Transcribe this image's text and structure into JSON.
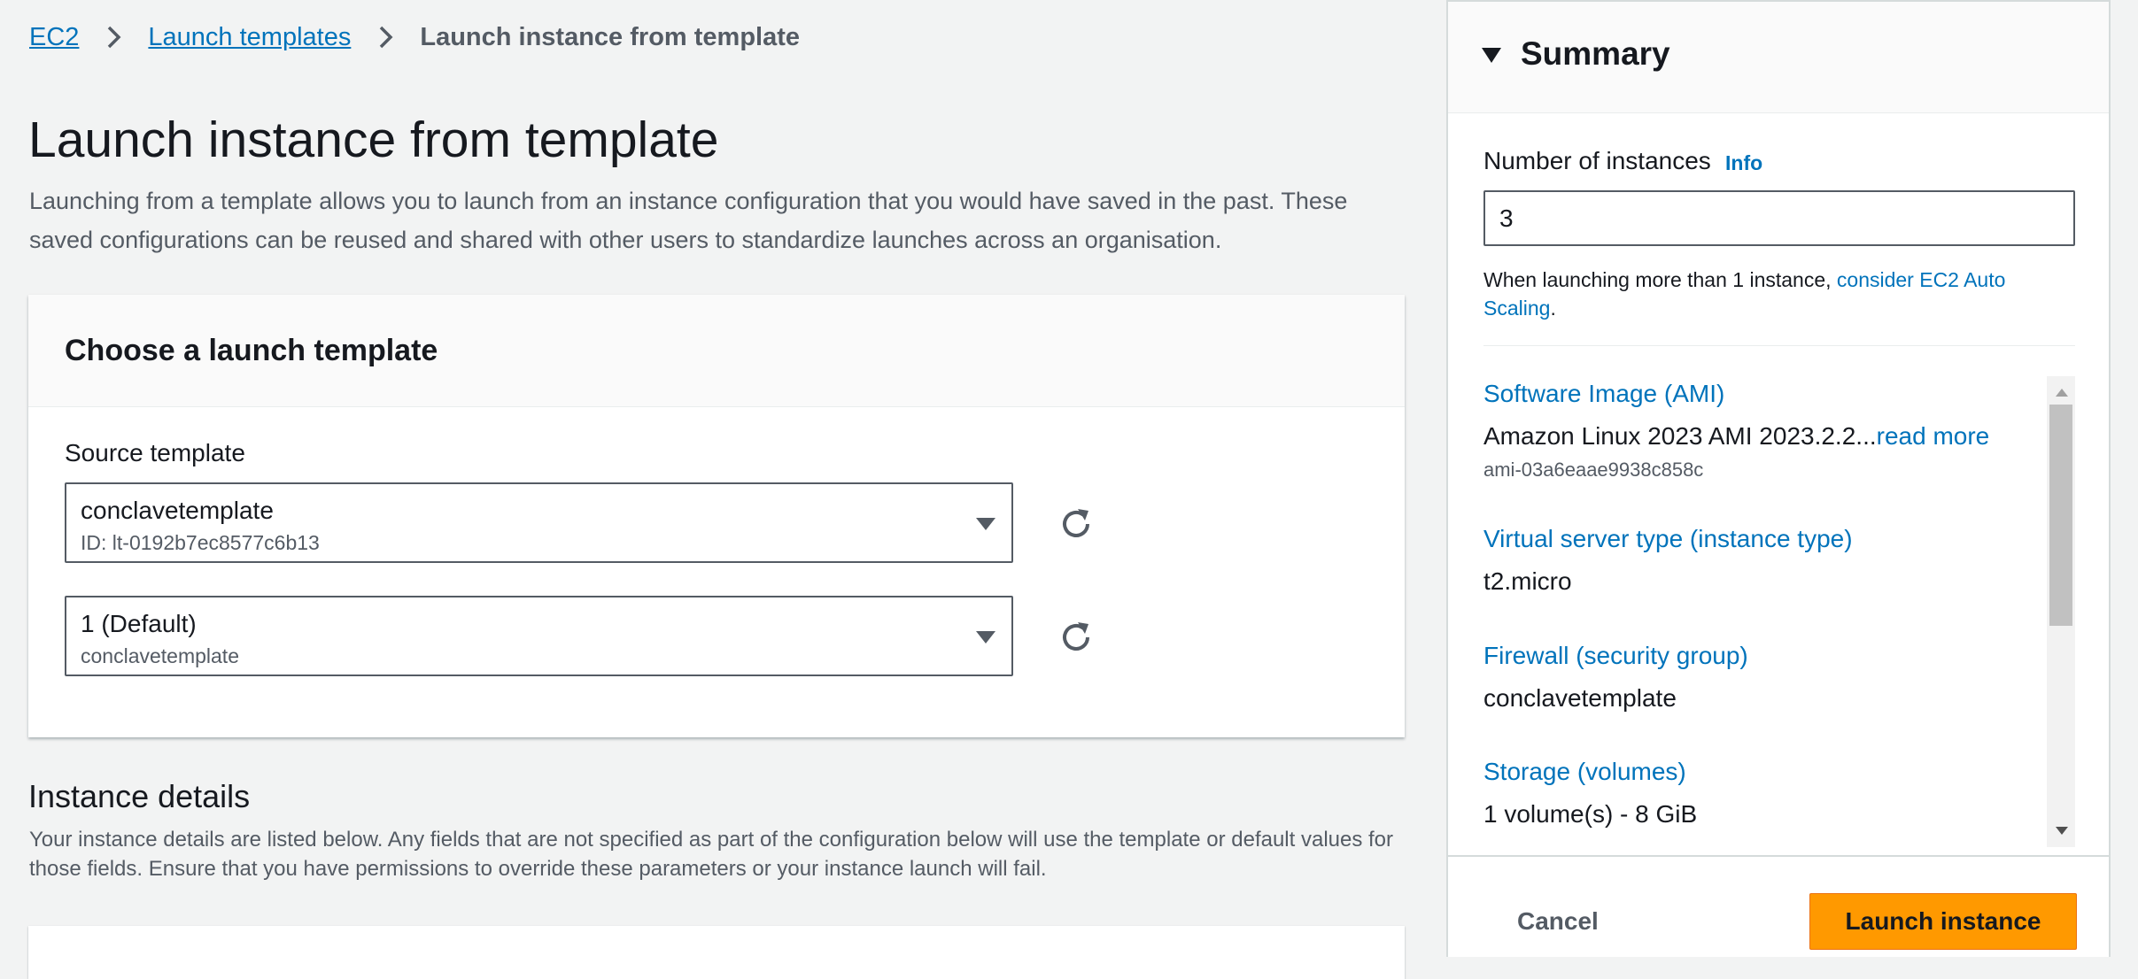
{
  "breadcrumb": {
    "items": [
      "EC2",
      "Launch templates"
    ],
    "current": "Launch instance from template",
    "separator_icon": "chevron-right-icon"
  },
  "header": {
    "title": "Launch instance from template",
    "description": "Launching from a template allows you to launch from an instance configuration that you would have saved in the past. These saved configurations can be reused and shared with other users to standardize launches across an organisation."
  },
  "choose_template": {
    "title": "Choose a launch template",
    "source_label": "Source template",
    "template_select": {
      "value": "conclavetemplate",
      "sub": "ID: lt-0192b7ec8577c6b13"
    },
    "version_select": {
      "value": "1 (Default)",
      "sub": "conclavetemplate"
    },
    "refresh_icon": "refresh-icon"
  },
  "instance_details": {
    "title": "Instance details",
    "description": "Your instance details are listed below. Any fields that are not specified as part of the configuration below will use the template or default values for those fields. Ensure that you have permissions to override these parameters or your instance launch will fail."
  },
  "summary": {
    "title": "Summary",
    "number_label": "Number of instances",
    "info_label": "Info",
    "number_value": "3",
    "hint_prefix": "When launching more than 1 instance, ",
    "hint_link": "consider EC2 Auto Scaling",
    "hint_suffix": ".",
    "ami_label": "Software Image (AMI)",
    "ami_value": "Amazon Linux 2023 AMI 2023.2.2...",
    "ami_read_more": "read more",
    "ami_id": "ami-03a6eaae9938c858c",
    "instance_type_label": "Virtual server type (instance type)",
    "instance_type_value": "t2.micro",
    "firewall_label": "Firewall (security group)",
    "firewall_value": "conclavetemplate",
    "storage_label": "Storage (volumes)",
    "storage_value": "1 volume(s) - 8 GiB",
    "cancel_label": "Cancel",
    "launch_label": "Launch instance"
  },
  "colors": {
    "link": "#0073bb",
    "primary_button": "#ff9900",
    "page_background": "#f2f3f3",
    "text": "#16191f",
    "secondary_text": "#545b64"
  }
}
